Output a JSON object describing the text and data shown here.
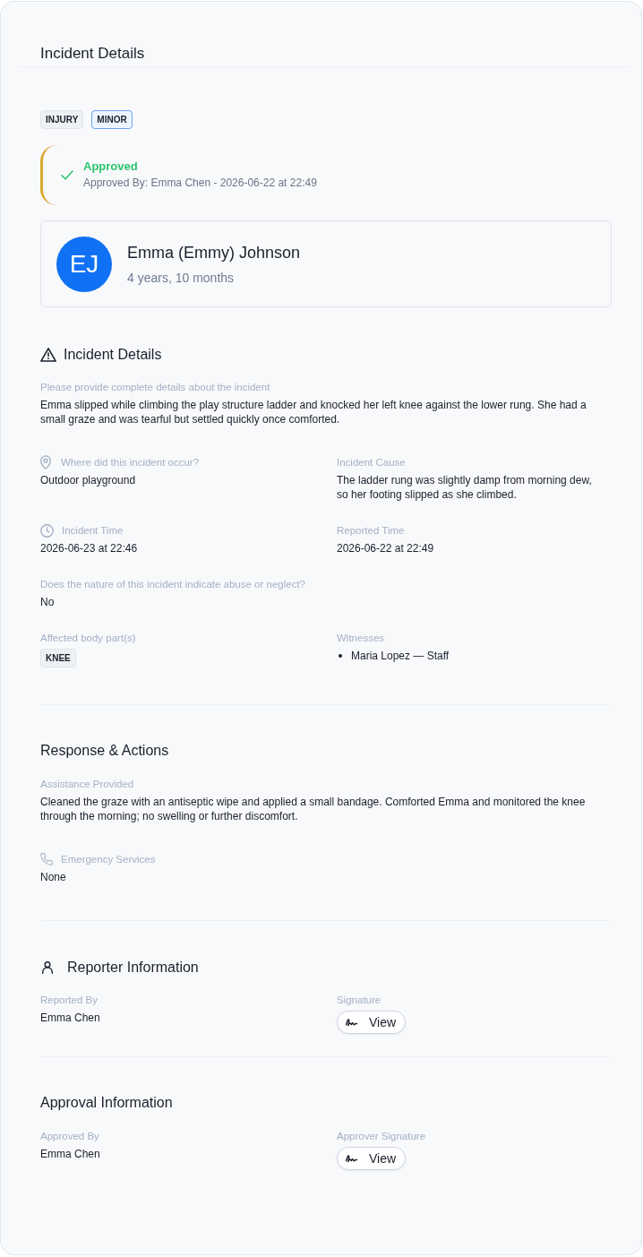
{
  "header": {
    "title": "Incident Details"
  },
  "tags": [
    {
      "label": "INJURY",
      "kind": "category"
    },
    {
      "label": "MINOR",
      "kind": "severity"
    }
  ],
  "status": {
    "kind": "approved",
    "label": "Approved",
    "detail": "Approved By: Emma Chen - 2026-06-22 at 22:49"
  },
  "child": {
    "initials": "EJ",
    "name": "Emma (Emmy) Johnson",
    "age": "4 years, 10 months"
  },
  "incident_details": {
    "title": "Incident Details",
    "description": {
      "label": "Please provide complete details about the incident",
      "value": "Emma slipped while climbing the play structure ladder and knocked her left knee against the lower rung. She had a small graze and was tearful but settled quickly once comforted."
    },
    "location": {
      "label": "Where did this incident occur?",
      "value": "Outdoor playground"
    },
    "cause": {
      "label": "Incident Cause",
      "value": "The ladder rung was slightly damp from morning dew, so her footing slipped as she climbed."
    },
    "incident_time": {
      "label": "Incident Time",
      "value": "2026-06-23 at 22:46"
    },
    "reported_time": {
      "label": "Reported Time",
      "value": "2026-06-22 at 22:49"
    },
    "abuse_or_neglect": {
      "label": "Does the nature of this incident indicate abuse or neglect?",
      "value": "No"
    },
    "body_parts": {
      "label": "Affected body part(s)",
      "tags": [
        "KNEE"
      ]
    },
    "witnesses": {
      "label": "Witnesses",
      "items": [
        "Maria Lopez — Staff"
      ]
    }
  },
  "response_actions": {
    "title": "Response & Actions",
    "assistance": {
      "label": "Assistance Provided",
      "value": "Cleaned the graze with an antiseptic wipe and applied a small bandage. Comforted Emma and monitored the knee through the morning; no swelling or further discomfort."
    },
    "emergency_services": {
      "label": "Emergency Services",
      "value": "None"
    }
  },
  "reporter_information": {
    "title": "Reporter Information",
    "reported_by": {
      "label": "Reported By",
      "value": "Emma Chen"
    },
    "signature": {
      "label": "Signature",
      "button": "View"
    }
  },
  "approval_information": {
    "title": "Approval Information",
    "approved_by": {
      "label": "Approved By",
      "value": "Emma Chen"
    },
    "approver_signature": {
      "label": "Approver Signature",
      "button": "View"
    }
  }
}
